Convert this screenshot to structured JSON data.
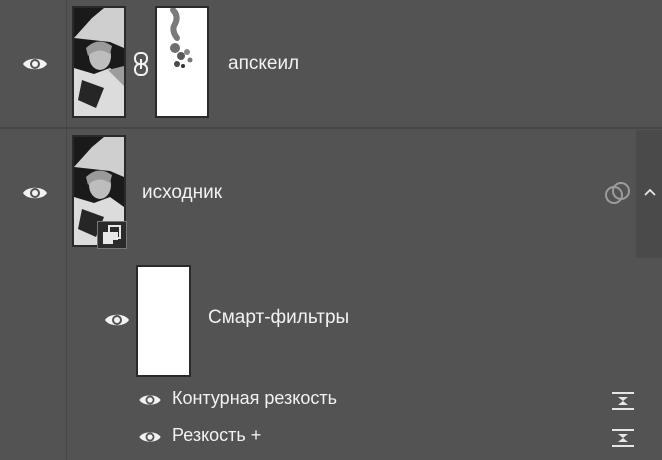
{
  "panel": "layers",
  "layers": [
    {
      "name": "апскеил",
      "visible": true,
      "has_mask": true,
      "mask_linked": true
    },
    {
      "name": "исходник",
      "visible": true,
      "smart_object": true,
      "expanded": true,
      "smart_filters": {
        "label": "Смарт-фильтры",
        "visible": true,
        "filters": [
          {
            "name": "Контурная резкость",
            "visible": true
          },
          {
            "name": "Резкость +",
            "visible": true
          }
        ]
      }
    }
  ],
  "icons": {
    "eye": "eye-icon",
    "link": "chain-link-icon",
    "smart_object": "smart-object-icon",
    "smart_filter": "smart-filter-icon",
    "collapse": "chevron-up-icon",
    "blend_options": "filter-blending-options-icon"
  },
  "colors": {
    "panel_bg": "#535353",
    "text": "#f2f2f2",
    "separator": "#464646"
  }
}
